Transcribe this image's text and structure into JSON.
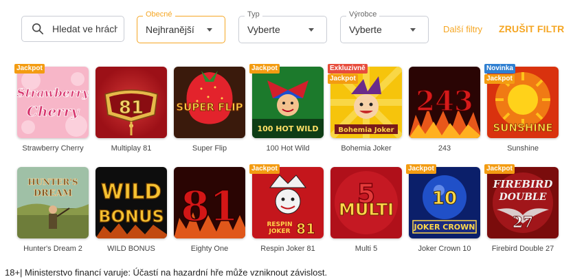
{
  "search": {
    "placeholder": "Hledat ve hrách"
  },
  "filters": [
    {
      "legend": "Obecné",
      "value": "Nejhranější",
      "active": true
    },
    {
      "legend": "Typ",
      "value": "Vyberte",
      "active": false
    },
    {
      "legend": "Výrobce",
      "value": "Vyberte",
      "active": false
    }
  ],
  "more_filters_label": "Další filtry",
  "clear_filter_label": "ZRUŠIT FILTR",
  "games": [
    {
      "title": "Strawberry Cherry",
      "badges": [
        "Jackpot"
      ],
      "art": "Strawberry Cherry",
      "icon": "strawberry-cherry-art"
    },
    {
      "title": "Multiplay 81",
      "badges": [],
      "art": "81",
      "icon": "multiplay-81-art"
    },
    {
      "title": "Super Flip",
      "badges": [],
      "art": "SUPER FLIP",
      "icon": "super-flip-art"
    },
    {
      "title": "100 Hot Wild",
      "badges": [
        "Jackpot"
      ],
      "art": "100 HOT WILD",
      "icon": "100-hot-wild-art"
    },
    {
      "title": "Bohemia Joker",
      "badges": [
        "Exkluzivně",
        "Jackpot"
      ],
      "art": "Bohemia Joker",
      "icon": "bohemia-joker-art"
    },
    {
      "title": "243",
      "badges": [],
      "art": "243",
      "icon": "243-art"
    },
    {
      "title": "Sunshine",
      "badges": [
        "Novinka",
        "Jackpot"
      ],
      "art": "SUNSHINE",
      "icon": "sunshine-art"
    },
    {
      "title": "Hunter's Dream 2",
      "badges": [],
      "art": "HUNTER'S DREAM",
      "icon": "hunters-dream-art"
    },
    {
      "title": "WILD BONUS",
      "badges": [],
      "art": "WILD BONUS",
      "icon": "wild-bonus-art"
    },
    {
      "title": "Eighty One",
      "badges": [],
      "art": "81",
      "icon": "eighty-one-art"
    },
    {
      "title": "Respin Joker 81",
      "badges": [
        "Jackpot"
      ],
      "art": "RESPIN JOKER 81",
      "icon": "respin-joker-art"
    },
    {
      "title": "Multi 5",
      "badges": [],
      "art": "5 MULTI",
      "icon": "multi-5-art"
    },
    {
      "title": "Joker Crown 10",
      "badges": [
        "Jackpot"
      ],
      "art": "10 JOKER CROWN",
      "icon": "joker-crown-art"
    },
    {
      "title": "Firebird Double 27",
      "badges": [
        "Jackpot"
      ],
      "art": "FIREBIRD DOUBLE 27",
      "icon": "firebird-art"
    }
  ],
  "disclaimer": "18+| Ministerstvo financí varuje: Účastí na hazardní hře může vzniknout závislost.",
  "colors": {
    "accent": "#f5a623",
    "jackpot": "#f39c12",
    "exclusive": "#e74c3c",
    "new": "#2f7fd1"
  }
}
